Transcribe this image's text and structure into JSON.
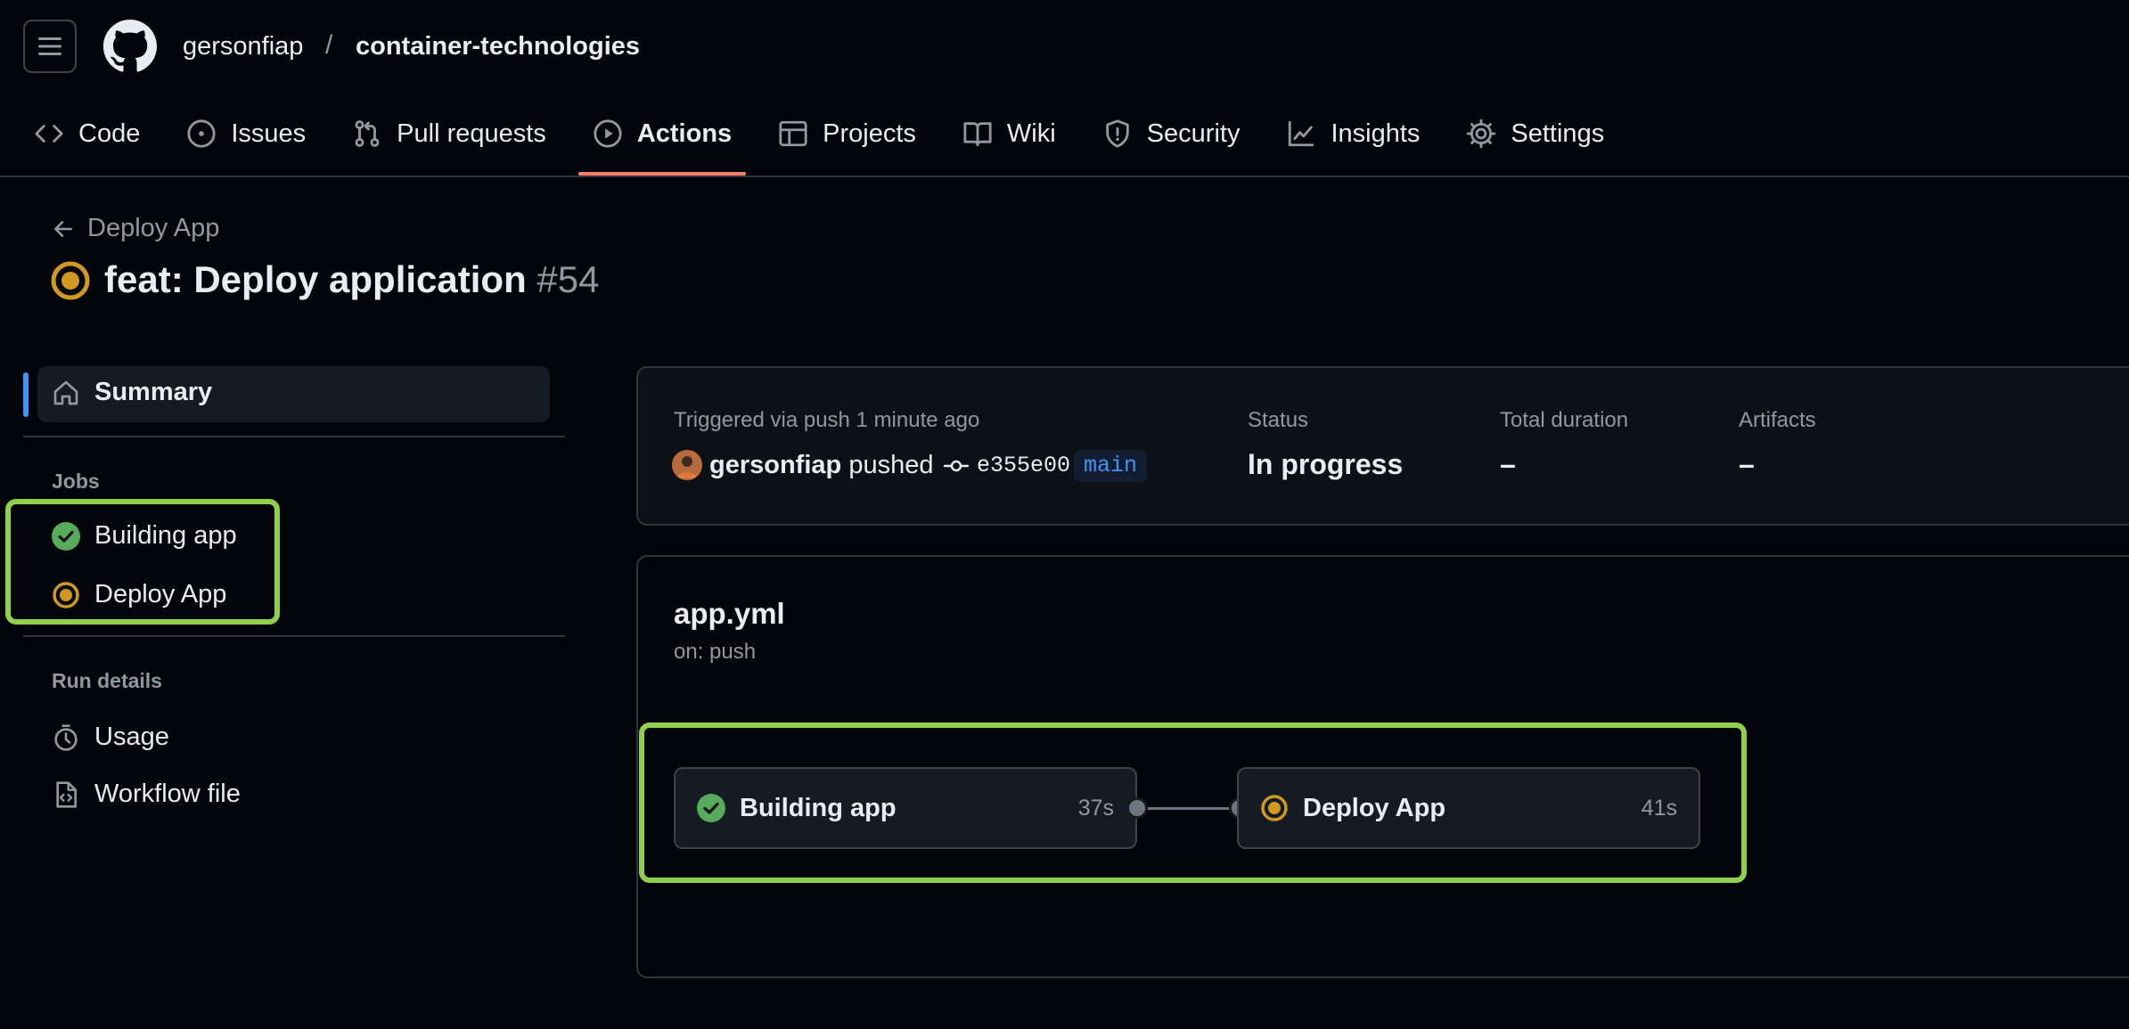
{
  "header": {
    "owner": "gersonfiap",
    "separator": "/",
    "repo": "container-technologies"
  },
  "nav": [
    {
      "label": "Code",
      "icon": "code-icon"
    },
    {
      "label": "Issues",
      "icon": "issue-icon"
    },
    {
      "label": "Pull requests",
      "icon": "pull-request-icon"
    },
    {
      "label": "Actions",
      "icon": "play-icon",
      "active": true
    },
    {
      "label": "Projects",
      "icon": "table-icon"
    },
    {
      "label": "Wiki",
      "icon": "book-icon"
    },
    {
      "label": "Security",
      "icon": "shield-icon"
    },
    {
      "label": "Insights",
      "icon": "graph-icon"
    },
    {
      "label": "Settings",
      "icon": "gear-icon"
    }
  ],
  "run": {
    "back_label": "Deploy App",
    "title": "feat: Deploy application",
    "number": "#54",
    "status_color": "#d29922"
  },
  "sidebar": {
    "summary_label": "Summary",
    "jobs_heading": "Jobs",
    "jobs": [
      {
        "label": "Building app",
        "status": "success"
      },
      {
        "label": "Deploy App",
        "status": "in-progress"
      }
    ],
    "run_details_heading": "Run details",
    "details": [
      {
        "label": "Usage",
        "icon": "stopwatch-icon"
      },
      {
        "label": "Workflow file",
        "icon": "file-code-icon"
      }
    ]
  },
  "summary": {
    "triggered": "Triggered via push 1 minute ago",
    "actor": "gersonfiap",
    "action": "pushed",
    "sha": "e355e00",
    "branch": "main",
    "status_label": "Status",
    "status_value": "In progress",
    "duration_label": "Total duration",
    "duration_value": "–",
    "artifacts_label": "Artifacts",
    "artifacts_value": "–"
  },
  "workflow": {
    "file": "app.yml",
    "trigger": "on: push",
    "jobs": [
      {
        "name": "Building app",
        "duration": "37s",
        "status": "success"
      },
      {
        "name": "Deploy App",
        "duration": "41s",
        "status": "in-progress"
      }
    ]
  },
  "colors": {
    "success": "#57ab5a",
    "in_progress": "#d29922",
    "accent": "#f78166",
    "link": "#4493f8",
    "highlight": "#8fd14f"
  }
}
